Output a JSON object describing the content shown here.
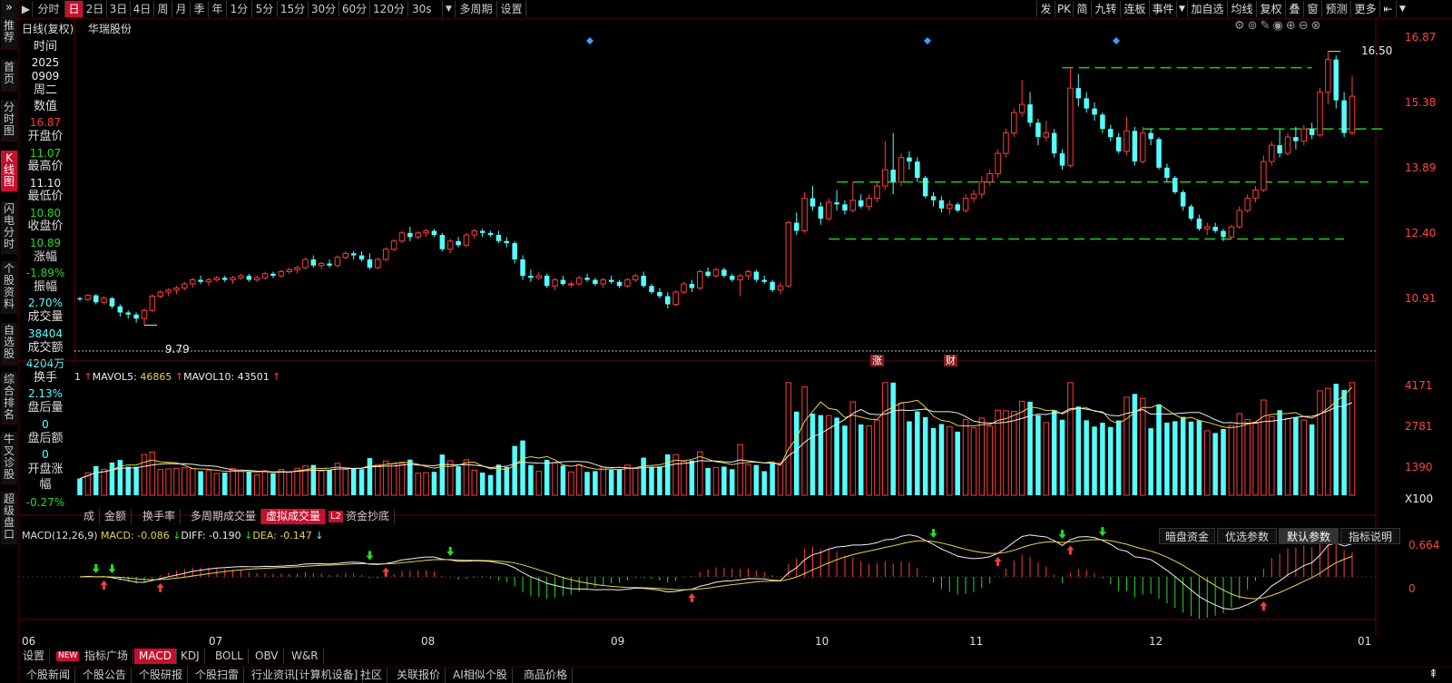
{
  "topbar": {
    "items": [
      "分时",
      "日",
      "2日",
      "3日",
      "4日",
      "周",
      "月",
      "季",
      "年",
      "1分",
      "5分",
      "15分",
      "30分",
      "60分",
      "120分",
      "30s",
      "多周期",
      "设置"
    ],
    "selected": "日",
    "right_items": [
      "发",
      "PK",
      "简",
      "九转",
      "连板",
      "事件",
      "加自选",
      "均线",
      "复权",
      "叠",
      "窗",
      "预测",
      "更多"
    ]
  },
  "leftnav": [
    "推荐",
    "首页",
    "分时图",
    "K线图",
    "闪电分时",
    "个股资料",
    "自选股",
    "综合排名",
    "牛叉诊股",
    "超级盘口"
  ],
  "chart_header": {
    "title": "日线(复权)",
    "stock": "华瑞股份"
  },
  "info": {
    "time_label": "时间",
    "year": "2025",
    "date": "0909",
    "weekday": "周二",
    "value_label": "数值",
    "value": "16.87",
    "open_label": "开盘价",
    "open": "11.07",
    "high_label": "最高价",
    "high": "11.10",
    "low_label": "最低价",
    "low": "10.80",
    "close_label": "收盘价",
    "close": "10.89",
    "chg_label": "涨幅",
    "chg": "-1.89%",
    "amp_label": "振幅",
    "amp": "2.70%",
    "vol_label": "成交量",
    "vol": "38404",
    "amt_label": "成交额",
    "amt": "4204万",
    "turn_label": "换手",
    "turn": "2.13%",
    "after_vol_label": "盘后量",
    "after_vol": "0",
    "after_amt_label": "盘后额",
    "after_amt": "0",
    "open_chg_label": "开盘涨幅",
    "open_chg": "-0.27%"
  },
  "price_axis": [
    "16.87",
    "15.38",
    "13.89",
    "12.40",
    "10.91"
  ],
  "annotations": {
    "max": "16.50",
    "min": "9.79",
    "zhang": "涨",
    "cai": "财"
  },
  "volume": {
    "legend_mavol5_label": "MAVOL5:",
    "mavol5": "46865",
    "legend_mavol10_label": "MAVOL10:",
    "mavol10": "43501",
    "axis": [
      "4171",
      "2781",
      "1390",
      "X100"
    ],
    "tabs": [
      "成交量",
      "金额",
      "换手率",
      "多周期成交量",
      "虚拟成交量",
      "资金抄底"
    ],
    "tabs_selected": "虚拟成交量",
    "badge": "L2"
  },
  "macd": {
    "title": "MACD(12,26,9)",
    "macd_label": "MACD:",
    "macd": "-0.086",
    "diff_label": "DIFF:",
    "diff": "-0.190",
    "dea_label": "DEA:",
    "dea": "-0.147",
    "axis": [
      "0.664",
      "0"
    ],
    "buttons": [
      "暗盘资金",
      "优选参数",
      "默认参数",
      "指标说明"
    ],
    "selected_button": "默认参数"
  },
  "months": [
    "06",
    "07",
    "08",
    "09",
    "10",
    "11",
    "12",
    "01"
  ],
  "indicator_tabs": {
    "settings": "设置",
    "new_badge": "NEW",
    "items": [
      "指标广场",
      "MACD",
      "KDJ",
      "BOLL",
      "OBV",
      "W&R"
    ],
    "selected": "MACD"
  },
  "news_tabs": [
    "个股新闻",
    "个股公告",
    "个股研报",
    "个股扫雷",
    "行业资讯[计算机设备]",
    "社区",
    "关联报价",
    "AI相似个股",
    "商品价格"
  ],
  "colors": {
    "up": "#ff3b3b",
    "down": "#5ff",
    "accent": "#c8102e",
    "ma": "#e8d44a"
  },
  "chart_data": {
    "type": "candlestick",
    "title": "华瑞股份",
    "ylim": [
      9.2,
      16.87
    ],
    "series": [
      {
        "name": "K",
        "values": [
          [
            10.45,
            10.48,
            10.38,
            10.42
          ],
          [
            10.42,
            10.55,
            10.38,
            10.52
          ],
          [
            10.52,
            10.55,
            10.3,
            10.35
          ],
          [
            10.35,
            10.5,
            10.3,
            10.45
          ],
          [
            10.45,
            10.48,
            10.2,
            10.25
          ],
          [
            10.25,
            10.3,
            10.0,
            10.1
          ],
          [
            10.1,
            10.15,
            9.95,
            10.05
          ],
          [
            10.05,
            10.1,
            9.85,
            9.95
          ],
          [
            9.95,
            10.2,
            9.79,
            10.15
          ],
          [
            10.15,
            10.55,
            10.1,
            10.5
          ],
          [
            10.5,
            10.65,
            10.45,
            10.6
          ],
          [
            10.6,
            10.7,
            10.5,
            10.65
          ],
          [
            10.65,
            10.75,
            10.55,
            10.7
          ],
          [
            10.7,
            10.85,
            10.65,
            10.8
          ],
          [
            10.8,
            10.95,
            10.7,
            10.9
          ],
          [
            10.9,
            11.0,
            10.8,
            10.85
          ],
          [
            10.85,
            10.95,
            10.75,
            10.9
          ],
          [
            10.9,
            11.0,
            10.85,
            10.95
          ],
          [
            10.95,
            11.0,
            10.85,
            10.9
          ],
          [
            10.9,
            11.0,
            10.8,
            10.95
          ],
          [
            10.95,
            11.05,
            10.9,
            11.0
          ],
          [
            11.0,
            11.05,
            10.85,
            10.9
          ],
          [
            10.9,
            11.0,
            10.85,
            10.95
          ],
          [
            10.95,
            11.1,
            10.9,
            11.05
          ],
          [
            11.05,
            11.1,
            10.95,
            11.0
          ],
          [
            11.0,
            11.15,
            10.95,
            11.1
          ],
          [
            11.1,
            11.2,
            11.05,
            11.15
          ],
          [
            11.15,
            11.25,
            11.05,
            11.2
          ],
          [
            11.2,
            11.45,
            11.15,
            11.4
          ],
          [
            11.4,
            11.5,
            11.2,
            11.25
          ],
          [
            11.25,
            11.35,
            11.15,
            11.3
          ],
          [
            11.3,
            11.4,
            11.2,
            11.25
          ],
          [
            11.25,
            11.5,
            11.2,
            11.45
          ],
          [
            11.45,
            11.6,
            11.4,
            11.55
          ],
          [
            11.55,
            11.6,
            11.4,
            11.5
          ],
          [
            11.5,
            11.6,
            11.35,
            11.4
          ],
          [
            11.4,
            11.55,
            11.15,
            11.2
          ],
          [
            11.2,
            11.45,
            11.15,
            11.4
          ],
          [
            11.4,
            11.7,
            11.35,
            11.65
          ],
          [
            11.65,
            11.9,
            11.6,
            11.85
          ],
          [
            11.85,
            12.1,
            11.8,
            12.05
          ],
          [
            12.05,
            12.2,
            11.85,
            11.95
          ],
          [
            11.95,
            12.1,
            11.9,
            12.05
          ],
          [
            12.05,
            12.15,
            11.95,
            12.1
          ],
          [
            12.1,
            12.15,
            11.95,
            12.0
          ],
          [
            12.0,
            12.05,
            11.6,
            11.65
          ],
          [
            11.65,
            11.9,
            11.55,
            11.85
          ],
          [
            11.85,
            11.95,
            11.7,
            11.75
          ],
          [
            11.75,
            12.05,
            11.7,
            12.0
          ],
          [
            12.0,
            12.15,
            11.9,
            12.1
          ],
          [
            12.1,
            12.15,
            11.95,
            12.05
          ],
          [
            12.05,
            12.1,
            11.95,
            12.0
          ],
          [
            12.0,
            12.1,
            11.8,
            11.85
          ],
          [
            11.85,
            11.95,
            11.7,
            11.8
          ],
          [
            11.8,
            11.85,
            11.3,
            11.4
          ],
          [
            11.4,
            11.5,
            10.9,
            11.0
          ],
          [
            11.0,
            11.15,
            10.85,
            10.95
          ],
          [
            10.95,
            11.1,
            10.9,
            11.0
          ],
          [
            11.0,
            11.05,
            10.7,
            10.75
          ],
          [
            10.75,
            10.95,
            10.65,
            10.9
          ],
          [
            10.9,
            11.0,
            10.75,
            10.8
          ],
          [
            10.8,
            10.85,
            10.7,
            10.8
          ],
          [
            10.8,
            11.0,
            10.75,
            10.95
          ],
          [
            10.95,
            11.05,
            10.85,
            10.9
          ],
          [
            10.9,
            10.95,
            10.75,
            10.8
          ],
          [
            10.8,
            10.95,
            10.7,
            10.9
          ],
          [
            10.9,
            11.0,
            10.8,
            10.85
          ],
          [
            10.85,
            10.9,
            10.7,
            10.75
          ],
          [
            10.75,
            10.95,
            10.7,
            10.9
          ],
          [
            10.9,
            11.05,
            10.85,
            11.0
          ],
          [
            11.0,
            11.1,
            10.7,
            10.75
          ],
          [
            10.75,
            10.8,
            10.55,
            10.6
          ],
          [
            10.6,
            10.7,
            10.45,
            10.5
          ],
          [
            10.5,
            10.6,
            10.2,
            10.3
          ],
          [
            10.3,
            10.65,
            10.25,
            10.6
          ],
          [
            10.6,
            10.85,
            10.55,
            10.8
          ],
          [
            10.8,
            10.9,
            10.6,
            10.7
          ],
          [
            10.7,
            11.15,
            10.65,
            11.1
          ],
          [
            11.1,
            11.2,
            10.95,
            11.0
          ],
          [
            11.0,
            11.2,
            10.95,
            11.15
          ],
          [
            11.15,
            11.2,
            10.95,
            11.0
          ],
          [
            11.0,
            11.05,
            10.85,
            10.9
          ],
          [
            10.9,
            11.05,
            10.5,
            11.0
          ],
          [
            11.0,
            11.15,
            10.9,
            11.1
          ],
          [
            11.1,
            11.15,
            10.85,
            10.9
          ],
          [
            10.9,
            11.0,
            10.8,
            10.85
          ],
          [
            10.85,
            10.9,
            10.6,
            10.65
          ],
          [
            10.65,
            10.85,
            10.55,
            10.75
          ],
          [
            10.75,
            12.35,
            10.7,
            12.3
          ],
          [
            12.3,
            12.55,
            12.0,
            12.1
          ],
          [
            12.1,
            13.05,
            12.05,
            12.9
          ],
          [
            12.9,
            13.2,
            12.6,
            12.7
          ],
          [
            12.7,
            12.8,
            12.25,
            12.4
          ],
          [
            12.4,
            12.9,
            12.35,
            12.8
          ],
          [
            12.8,
            13.1,
            12.6,
            12.75
          ],
          [
            12.75,
            12.85,
            12.5,
            12.6
          ],
          [
            12.6,
            13.3,
            12.55,
            12.85
          ],
          [
            12.85,
            13.0,
            12.65,
            12.7
          ],
          [
            12.7,
            13.0,
            12.6,
            12.9
          ],
          [
            12.9,
            13.3,
            12.8,
            13.2
          ],
          [
            13.2,
            14.3,
            13.1,
            13.6
          ],
          [
            13.6,
            14.5,
            13.0,
            13.3
          ],
          [
            13.3,
            14.0,
            13.2,
            13.9
          ],
          [
            13.9,
            14.05,
            13.6,
            13.8
          ],
          [
            13.8,
            13.9,
            13.3,
            13.4
          ],
          [
            13.4,
            13.45,
            12.9,
            12.95
          ],
          [
            12.95,
            13.05,
            12.7,
            12.85
          ],
          [
            12.85,
            12.95,
            12.55,
            12.65
          ],
          [
            12.65,
            12.85,
            12.5,
            12.75
          ],
          [
            12.75,
            12.8,
            12.55,
            12.6
          ],
          [
            12.6,
            13.0,
            12.55,
            12.9
          ],
          [
            12.9,
            13.1,
            12.8,
            13.0
          ],
          [
            13.0,
            13.45,
            12.9,
            13.3
          ],
          [
            13.3,
            13.6,
            13.2,
            13.5
          ],
          [
            13.5,
            14.1,
            13.4,
            14.0
          ],
          [
            14.0,
            14.6,
            13.9,
            14.5
          ],
          [
            14.5,
            15.1,
            14.4,
            15.0
          ],
          [
            15.0,
            15.8,
            14.9,
            15.2
          ],
          [
            15.2,
            15.5,
            14.65,
            14.75
          ],
          [
            14.75,
            14.85,
            14.2,
            14.4
          ],
          [
            14.4,
            14.8,
            14.3,
            14.5
          ],
          [
            14.5,
            14.6,
            13.9,
            14.0
          ],
          [
            14.0,
            14.1,
            13.6,
            13.7
          ],
          [
            13.7,
            16.1,
            13.65,
            15.6
          ],
          [
            15.6,
            15.95,
            15.15,
            15.35
          ],
          [
            15.35,
            15.5,
            15.0,
            15.1
          ],
          [
            15.1,
            15.25,
            14.8,
            14.95
          ],
          [
            14.95,
            15.0,
            14.5,
            14.6
          ],
          [
            14.6,
            14.7,
            14.3,
            14.4
          ],
          [
            14.4,
            14.5,
            14.0,
            14.05
          ],
          [
            14.05,
            14.9,
            13.95,
            14.55
          ],
          [
            14.55,
            14.65,
            13.7,
            13.8
          ],
          [
            13.8,
            14.65,
            13.75,
            14.5
          ],
          [
            14.5,
            14.6,
            14.2,
            14.35
          ],
          [
            14.35,
            14.4,
            13.6,
            13.65
          ],
          [
            13.65,
            13.75,
            13.3,
            13.4
          ],
          [
            13.4,
            13.45,
            13.0,
            13.05
          ],
          [
            13.05,
            13.1,
            12.6,
            12.7
          ],
          [
            12.7,
            12.75,
            12.35,
            12.4
          ],
          [
            12.4,
            12.5,
            12.1,
            12.15
          ],
          [
            12.15,
            12.3,
            12.0,
            12.2
          ],
          [
            12.2,
            12.3,
            12.05,
            12.1
          ],
          [
            12.1,
            12.15,
            11.85,
            11.95
          ],
          [
            11.95,
            12.25,
            11.9,
            12.2
          ],
          [
            12.2,
            12.7,
            12.15,
            12.6
          ],
          [
            12.6,
            13.0,
            12.55,
            12.9
          ],
          [
            12.9,
            13.2,
            12.8,
            13.1
          ],
          [
            13.1,
            13.95,
            13.05,
            13.8
          ],
          [
            13.8,
            14.3,
            13.7,
            14.2
          ],
          [
            14.2,
            14.6,
            13.9,
            14.0
          ],
          [
            14.0,
            14.5,
            13.95,
            14.4
          ],
          [
            14.4,
            14.65,
            14.1,
            14.3
          ],
          [
            14.3,
            14.7,
            14.2,
            14.6
          ],
          [
            14.6,
            14.75,
            14.35,
            14.45
          ],
          [
            14.45,
            15.6,
            14.4,
            15.5
          ],
          [
            15.5,
            16.5,
            15.2,
            16.3
          ],
          [
            16.3,
            16.4,
            15.1,
            15.3
          ],
          [
            15.3,
            15.5,
            14.4,
            14.5
          ],
          [
            14.5,
            15.9,
            14.45,
            15.4
          ]
        ]
      }
    ]
  }
}
